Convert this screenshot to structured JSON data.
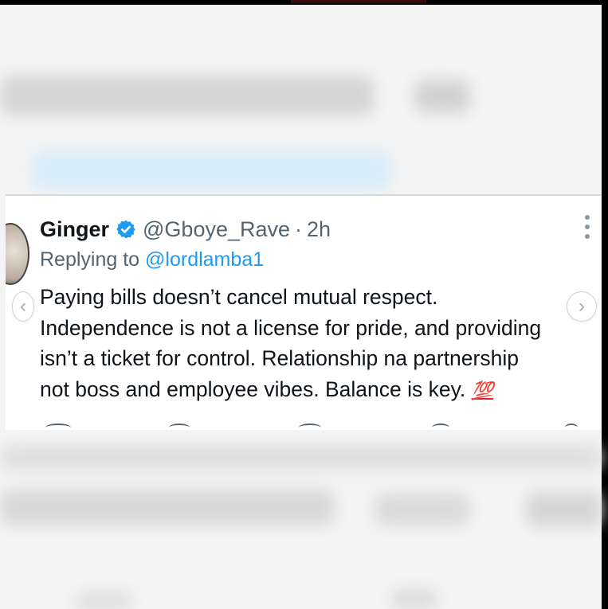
{
  "tweet": {
    "name": "Ginger",
    "handle": "@Gboye_Rave",
    "separator": "·",
    "time": "2h",
    "replying_prefix": "Replying to",
    "replying_to": "@lordlamba1",
    "lines": [
      "Paying bills doesn’t cancel mutual respect.",
      "Independence is not a license for pride, and providing",
      "isn’t a ticket for control. Relationship na partnership",
      "not boss and employee vibes. Balance is key."
    ],
    "emoji": "💯",
    "verified_icon": "verified-badge-icon",
    "verified_color": "#1d9bf0"
  },
  "nav": {
    "prev_glyph": "‹",
    "next_glyph": "›"
  },
  "colors": {
    "link": "#1d9bf0",
    "secondary_text": "#536471",
    "emoji_red": "#e0242b"
  }
}
